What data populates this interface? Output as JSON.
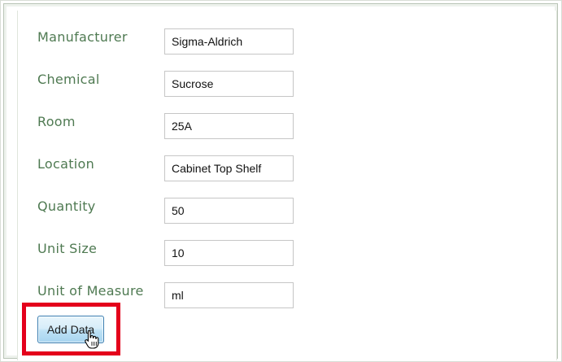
{
  "form": {
    "fields": [
      {
        "label": "Manufacturer",
        "value": "Sigma-Aldrich"
      },
      {
        "label": "Chemical",
        "value": "Sucrose"
      },
      {
        "label": "Room",
        "value": "25A"
      },
      {
        "label": "Location",
        "value": "Cabinet Top Shelf"
      },
      {
        "label": "Quantity",
        "value": "50"
      },
      {
        "label": "Unit Size",
        "value": "10"
      },
      {
        "label": "Unit of Measure",
        "value": "ml"
      }
    ],
    "submit_label": "Add Data"
  },
  "colors": {
    "label_text": "#4f7a52",
    "highlight": "#e4001b",
    "button_border": "#3c7fb1"
  },
  "icons": {
    "cursor": "hand-pointer-icon"
  }
}
